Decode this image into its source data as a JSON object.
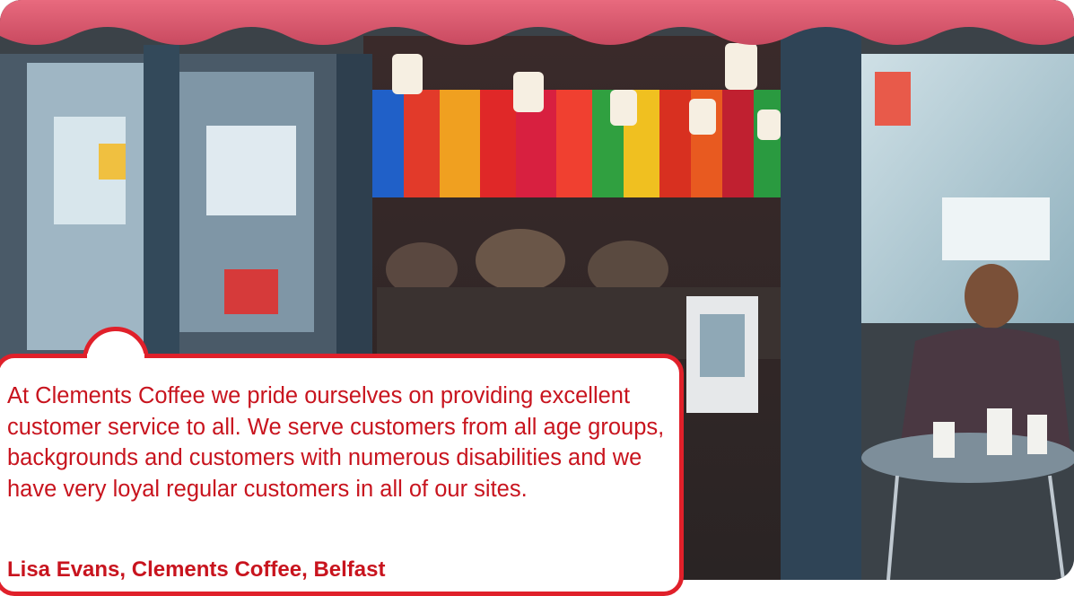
{
  "quote": {
    "text": "At Clements Coffee we pride ourselves on providing excellent customer service to all. We serve customers from all age groups, backgrounds and customers with numerous disabilities and we have very loyal regular customers in all of our sites.",
    "attribution": "Lisa Evans, Clements Coffee, Belfast"
  },
  "colors": {
    "accent": "#e0202a",
    "text": "#c8141e"
  }
}
